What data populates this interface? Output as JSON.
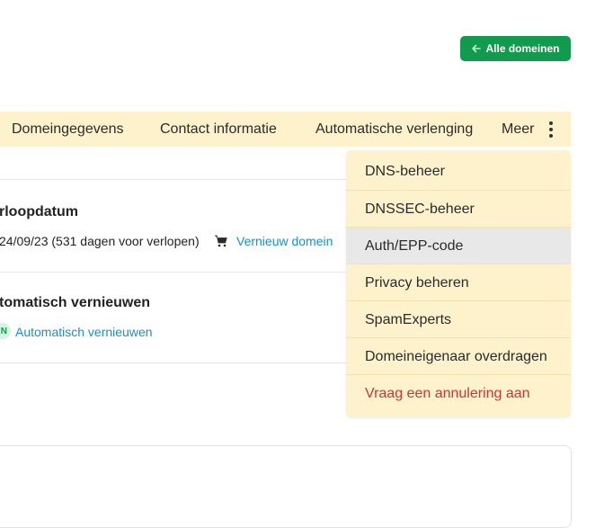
{
  "header": {
    "all_domains_label": "Alle domeinen"
  },
  "tabs": [
    {
      "label": "Domeingegevens"
    },
    {
      "label": "Contact informatie"
    },
    {
      "label": "Automatische verlenging"
    },
    {
      "label": "Meer"
    }
  ],
  "expiry": {
    "title": "rloopdatum",
    "text": "24/09/23 (531 dagen voor verlopen)",
    "renew_link": "Vernieuw domein"
  },
  "autorenew": {
    "title": "tomatisch vernieuwen",
    "badge": "N",
    "link": "Automatisch vernieuwen"
  },
  "dropdown": {
    "items": [
      {
        "label": "DNS-beheer"
      },
      {
        "label": "DNSSEC-beheer"
      },
      {
        "label": "Auth/EPP-code"
      },
      {
        "label": "Privacy beheren"
      },
      {
        "label": "SpamExperts"
      },
      {
        "label": "Domeineigenaar overdragen"
      },
      {
        "label": "Vraag een annulering aan"
      }
    ]
  },
  "colors": {
    "accent": "#129a4f",
    "tabbar": "#fdf2cc",
    "link": "#1a8fc8",
    "danger": "#d13434"
  }
}
